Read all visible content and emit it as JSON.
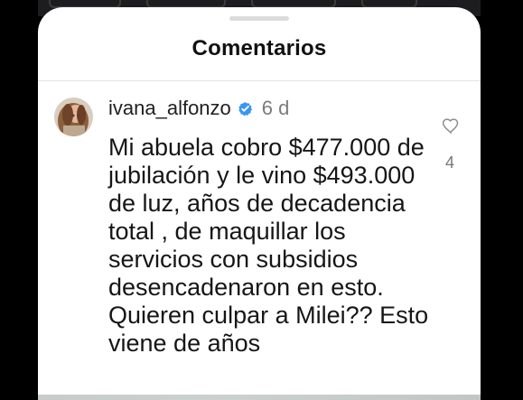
{
  "sheet": {
    "title": "Comentarios"
  },
  "comment": {
    "username": "ivana_alfonzo",
    "age": "6 d",
    "text": "Mi abuela cobro $477.000 de jubilación y le vino $493.000 de luz, años de decadencia total , de maquillar los servicios con subsidios desencadenaron en esto. Quieren culpar a Milei?? Esto viene de años",
    "like_count": "4",
    "icons": {
      "verified": "verified-badge-icon",
      "like": "heart-icon"
    }
  },
  "colors": {
    "background": "#000000",
    "sheet": "#ffffff",
    "verified": "#3897f0",
    "muted": "#7b7b7b",
    "text": "#161616"
  }
}
